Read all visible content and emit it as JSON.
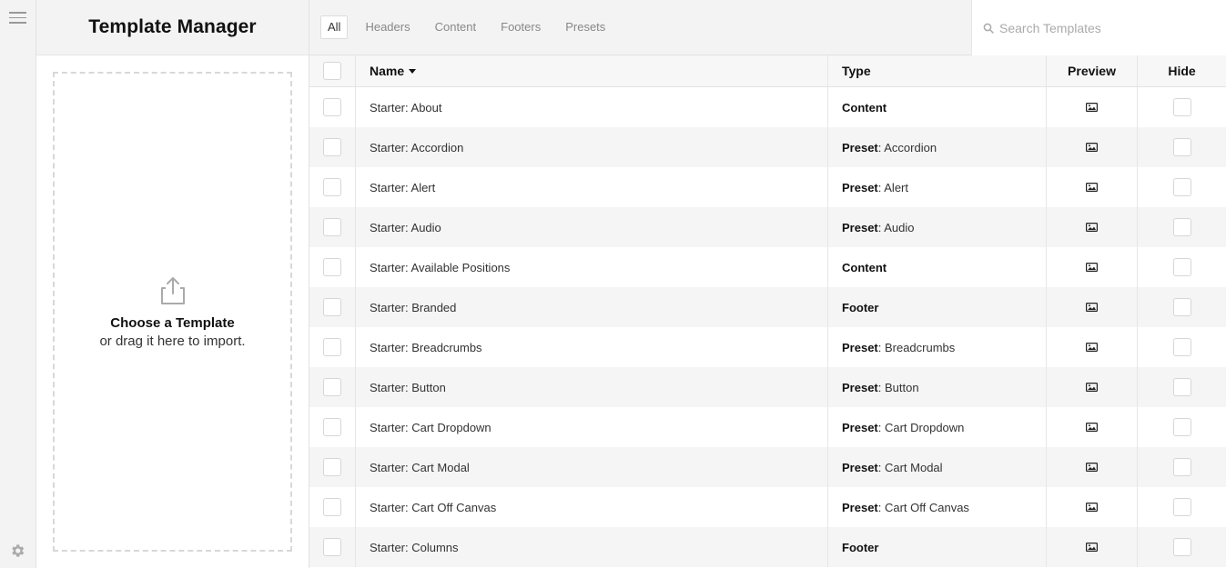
{
  "app": {
    "title": "Template Manager"
  },
  "import": {
    "title": "Choose a Template",
    "subtitle": "or drag it here to import."
  },
  "tabs": [
    {
      "label": "All",
      "active": true
    },
    {
      "label": "Headers",
      "active": false
    },
    {
      "label": "Content",
      "active": false
    },
    {
      "label": "Footers",
      "active": false
    },
    {
      "label": "Presets",
      "active": false
    }
  ],
  "search": {
    "placeholder": "Search Templates",
    "value": ""
  },
  "table": {
    "columns": {
      "name": "Name",
      "type": "Type",
      "preview": "Preview",
      "hide": "Hide"
    },
    "sort": {
      "column": "Name",
      "direction": "descending-caret"
    },
    "rows": [
      {
        "name": "Starter: About",
        "type": "Content",
        "detail": ""
      },
      {
        "name": "Starter: Accordion",
        "type": "Preset",
        "detail": ": Accordion"
      },
      {
        "name": "Starter: Alert",
        "type": "Preset",
        "detail": ": Alert"
      },
      {
        "name": "Starter: Audio",
        "type": "Preset",
        "detail": ": Audio"
      },
      {
        "name": "Starter: Available Positions",
        "type": "Content",
        "detail": ""
      },
      {
        "name": "Starter: Branded",
        "type": "Footer",
        "detail": ""
      },
      {
        "name": "Starter: Breadcrumbs",
        "type": "Preset",
        "detail": ": Breadcrumbs"
      },
      {
        "name": "Starter: Button",
        "type": "Preset",
        "detail": ": Button"
      },
      {
        "name": "Starter: Cart Dropdown",
        "type": "Preset",
        "detail": ": Cart Dropdown"
      },
      {
        "name": "Starter: Cart Modal",
        "type": "Preset",
        "detail": ": Cart Modal"
      },
      {
        "name": "Starter: Cart Off Canvas",
        "type": "Preset",
        "detail": ": Cart Off Canvas"
      },
      {
        "name": "Starter: Columns",
        "type": "Footer",
        "detail": ""
      }
    ]
  },
  "icons": {
    "menu": "hamburger-icon",
    "settings": "gear-icon",
    "upload": "upload-icon",
    "search": "search-icon",
    "preview": "image-icon"
  },
  "colors": {
    "rail_bg": "#f3f3f3",
    "stripe": "#f5f5f5",
    "border": "#e2e2e2",
    "muted_text": "#888888"
  }
}
